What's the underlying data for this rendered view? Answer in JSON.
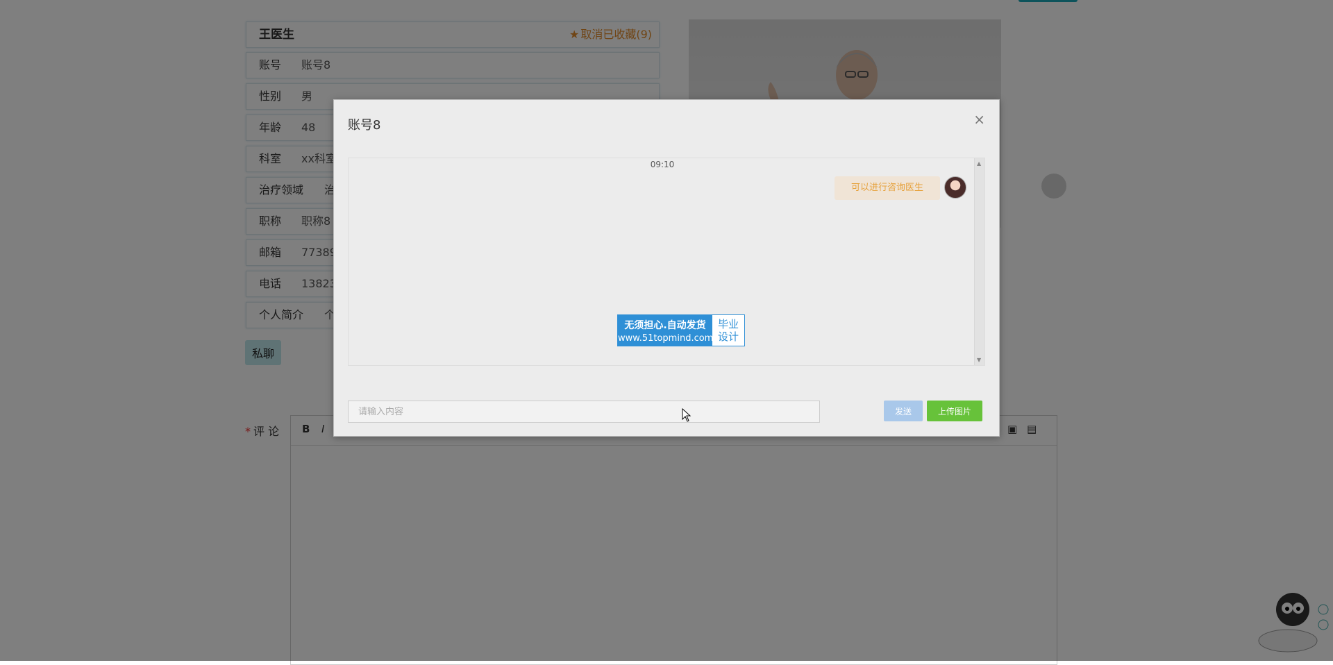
{
  "doctor": {
    "name": "王医生",
    "favorite_label": "取消已收藏(9)",
    "fields": [
      {
        "label": "账号",
        "value": "账号8"
      },
      {
        "label": "性别",
        "value": "男"
      },
      {
        "label": "年龄",
        "value": "48"
      },
      {
        "label": "科室",
        "value": "xx科室"
      },
      {
        "label": "治疗领域",
        "value": "治"
      },
      {
        "label": "职称",
        "value": "职称8"
      },
      {
        "label": "邮箱",
        "value": "77389"
      },
      {
        "label": "电话",
        "value": "13823"
      },
      {
        "label": "个人简介",
        "value": "个"
      }
    ],
    "chat_button": "私聊"
  },
  "comment": {
    "required_mark": "*",
    "label": "评 论",
    "toolbar": {
      "bold": "B",
      "italic": "I"
    }
  },
  "modal": {
    "title": "账号8",
    "close": "×",
    "messages": [
      {
        "time": "09:10",
        "text": "可以进行咨询医生"
      }
    ],
    "watermark": {
      "line1": "无须担心.自动发货",
      "line2": "www.51topmind.com",
      "side1": "毕业",
      "side2": "设计"
    },
    "input_placeholder": "请输入内容",
    "send_label": "发送",
    "upload_label": "上传图片"
  },
  "colors": {
    "accent": "#1aa6b7",
    "favorite": "#e08a2a",
    "send": "#a9c8ea",
    "upload": "#67c23a",
    "bubble_text": "#e6a13b"
  }
}
